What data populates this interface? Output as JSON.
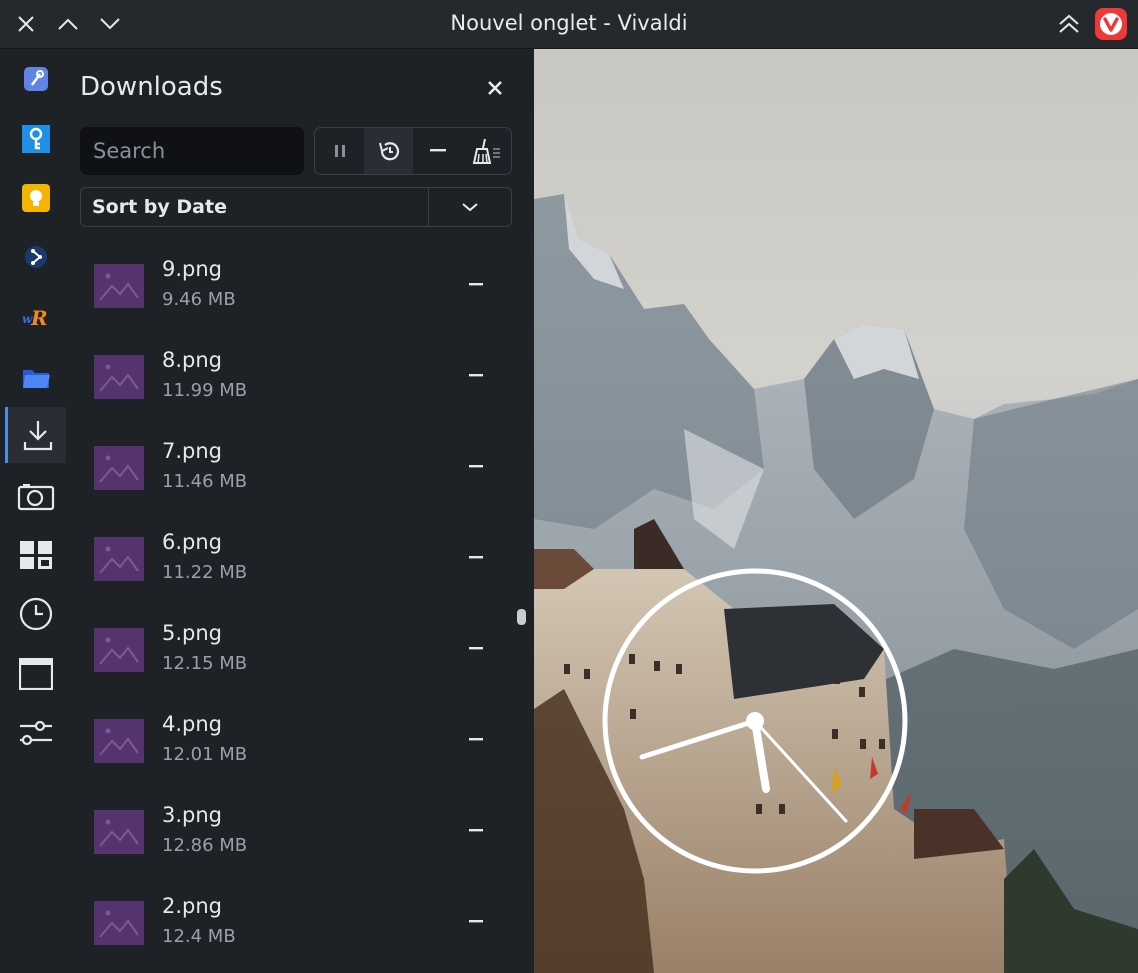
{
  "window": {
    "title": "Nouvel onglet - Vivaldi"
  },
  "panel": {
    "title": "Downloads",
    "search_placeholder": "Search",
    "sort_label": "Sort by Date"
  },
  "downloads": [
    {
      "name": "9.png",
      "size": "9.46 MB"
    },
    {
      "name": "8.png",
      "size": "11.99 MB"
    },
    {
      "name": "7.png",
      "size": "11.46 MB"
    },
    {
      "name": "6.png",
      "size": "11.22 MB"
    },
    {
      "name": "5.png",
      "size": "12.15 MB"
    },
    {
      "name": "4.png",
      "size": "12.01 MB"
    },
    {
      "name": "3.png",
      "size": "12.86 MB"
    },
    {
      "name": "2.png",
      "size": "12.4 MB"
    }
  ],
  "sidebar_icons": [
    "vivaldi-settings-icon",
    "key-icon",
    "lightbulb-icon",
    "share-icon",
    "wr-icon",
    "folder-icon",
    "downloads-icon",
    "capture-icon",
    "window-panel-icon",
    "clock-icon",
    "window-icon",
    "sliders-icon"
  ],
  "colors": {
    "accent": "#4a90e2",
    "brand": "#ef3939",
    "thumbnail": "#55336f"
  }
}
